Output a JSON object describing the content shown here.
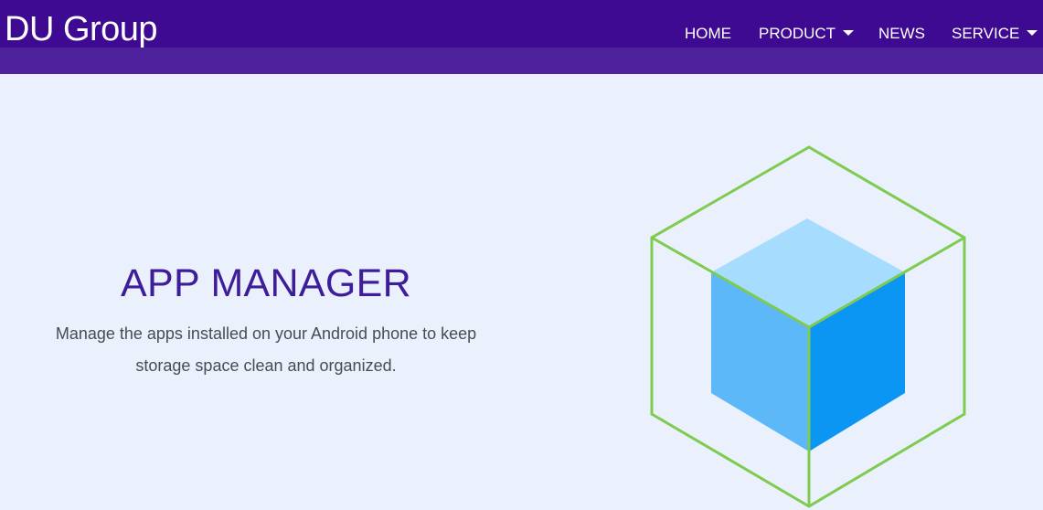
{
  "brand": {
    "name": "DU Group"
  },
  "nav": {
    "items": [
      {
        "label": "HOME"
      },
      {
        "label": "PRODUCT"
      },
      {
        "label": "NEWS"
      },
      {
        "label": "SERVICE"
      }
    ]
  },
  "hero": {
    "title": "APP MANAGER",
    "description": "Manage the apps installed on your Android phone to keep storage space clean and organized."
  },
  "colors": {
    "header": "#3d0a91",
    "header_band": "#4d219c",
    "page_background": "#eaf1fc",
    "title": "#3d1d9a",
    "cube_outline": "#7ecb4f",
    "cube_top": "#a6dcfd",
    "cube_left": "#5cb8f6",
    "cube_right": "#0a96f2"
  },
  "illustration": {
    "icon": "cube-icon"
  }
}
